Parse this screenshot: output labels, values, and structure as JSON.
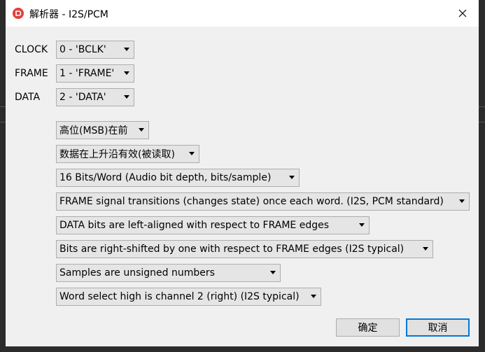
{
  "window": {
    "title": "解析器 - I2S/PCM",
    "accent_color": "#e0403a"
  },
  "channels": [
    {
      "label": "CLOCK",
      "value": "0 - 'BCLK'"
    },
    {
      "label": "FRAME",
      "value": "1 - 'FRAME'"
    },
    {
      "label": "DATA",
      "value": "2 - 'DATA'"
    }
  ],
  "options": [
    "高位(MSB)在前",
    "数据在上升沿有效(被读取)",
    "16 Bits/Word (Audio bit depth, bits/sample)",
    "FRAME signal transitions (changes state) once each word. (I2S, PCM standard)",
    "DATA bits are left-aligned with respect to FRAME edges",
    "Bits are right-shifted by one with respect to FRAME edges (I2S typical)",
    "Samples are unsigned numbers",
    "Word select high is channel 2 (right) (I2S typical)"
  ],
  "buttons": {
    "ok": "确定",
    "cancel": "取消"
  }
}
